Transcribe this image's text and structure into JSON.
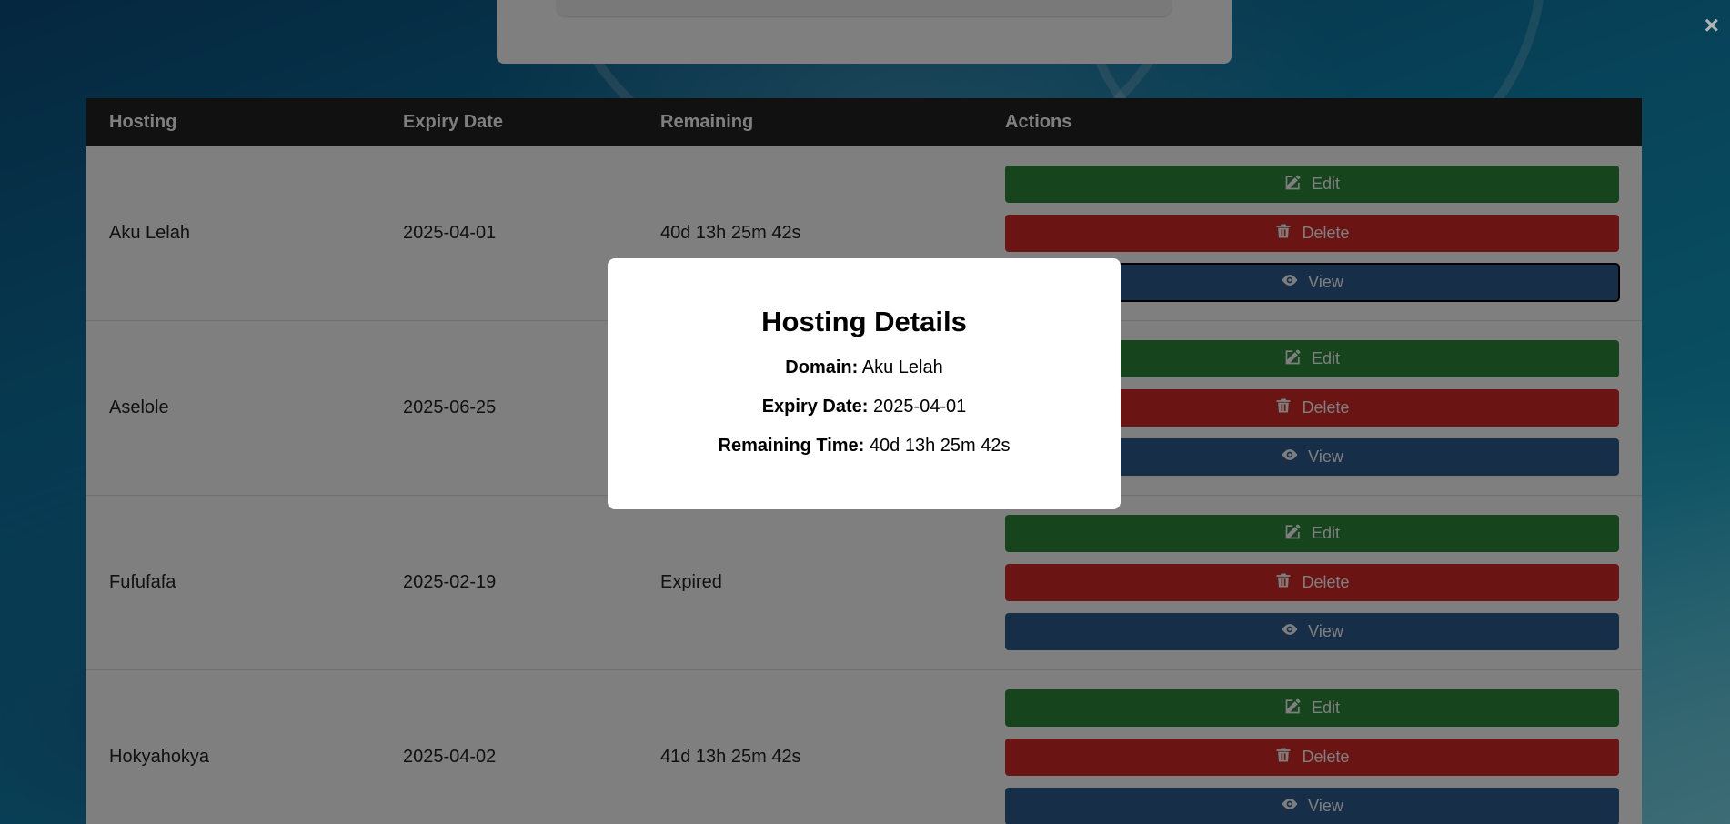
{
  "close_label": "×",
  "top_card": {},
  "table": {
    "headers": [
      "Hosting",
      "Expiry Date",
      "Remaining",
      "Actions"
    ],
    "rows": [
      {
        "hosting": "Aku Lelah",
        "expiry": "2025-04-01",
        "remaining": "40d 13h 25m 42s"
      },
      {
        "hosting": "Aselole",
        "expiry": "2025-06-25",
        "remaining": ""
      },
      {
        "hosting": "Fufufafa",
        "expiry": "2025-02-19",
        "remaining": "Expired"
      },
      {
        "hosting": "Hokyahokya",
        "expiry": "2025-04-02",
        "remaining": "41d 13h 25m 42s"
      }
    ],
    "actions": {
      "edit": "Edit",
      "delete": "Delete",
      "view": "View"
    }
  },
  "modal": {
    "title": "Hosting Details",
    "domain_label": "Domain:",
    "domain_value": "Aku Lelah",
    "expiry_label": "Expiry Date:",
    "expiry_value": "2025-04-01",
    "remaining_label": "Remaining Time:",
    "remaining_value": "40d 13h 25m 42s"
  },
  "colors": {
    "edit": "#2c8a3b",
    "delete": "#d42828",
    "view": "#2e5c93",
    "header": "#222222"
  },
  "icons": {
    "edit": "edit-icon",
    "delete": "trash-icon",
    "view": "eye-icon"
  }
}
